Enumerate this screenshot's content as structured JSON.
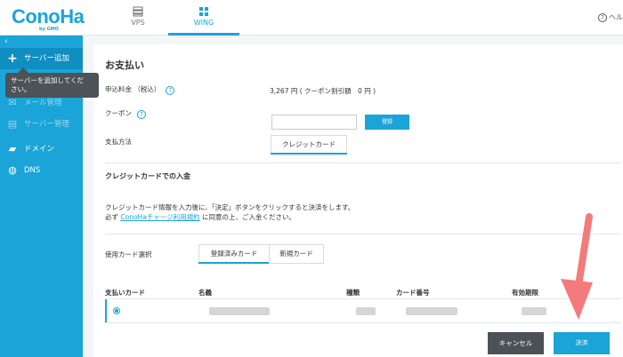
{
  "brand": {
    "logo": "ConoHa",
    "logo_sub": "by GMO"
  },
  "top_tabs": [
    {
      "label": "VPS",
      "icon": "server-icon"
    },
    {
      "label": "WING",
      "icon": "wing-icon",
      "active": true
    }
  ],
  "help_label": "ヘル",
  "sidebar": {
    "collapse_icon": "chevron-left-icon",
    "items": [
      {
        "label": "サーバー追加",
        "icon": "plus-icon",
        "active": true
      },
      {
        "label": "メール管理",
        "icon": "mail-icon"
      },
      {
        "label": "サーバー管理",
        "icon": "server-icon"
      },
      {
        "label": "ドメイン",
        "icon": "domain-icon"
      },
      {
        "label": "DNS",
        "icon": "globe-icon"
      }
    ],
    "tooltip_line1": "サーバーを追加してくだ",
    "tooltip_line2": "さい。"
  },
  "page": {
    "title": "お支払い",
    "fee_label": "申込料金 （税込）",
    "fee_value": "3,267 円 ( クーポン割引額　0 円 )",
    "coupon_label": "クーポン",
    "coupon_placeholder": "",
    "coupon_button": "登録",
    "method_label": "支払方法",
    "method_tab": "クレジットカード",
    "section_title": "クレジットカードでの入金",
    "desc_line1": "クレジットカード情報を入力後に、「決定」ボタンをクリックすると決済をします。",
    "desc_line2_pre": "必ず ",
    "desc_link": "ConoHaチャージ利用規約",
    "desc_line2_post": " に同意の上、ご入金ください。",
    "card_select_label": "使用カード選択",
    "card_tabs": [
      "登録済みカード",
      "新規カード"
    ],
    "table_headers": [
      "支払いカード",
      "名義",
      "種類",
      "カード番号",
      "有効期限"
    ],
    "cancel_button": "キャンセル",
    "pay_button": "決済"
  },
  "colors": {
    "accent": "#1aa4d8",
    "sidebar_bg": "#1aa4d8",
    "cancel_bg": "#4b5157",
    "arrow": "#f37b7b"
  }
}
